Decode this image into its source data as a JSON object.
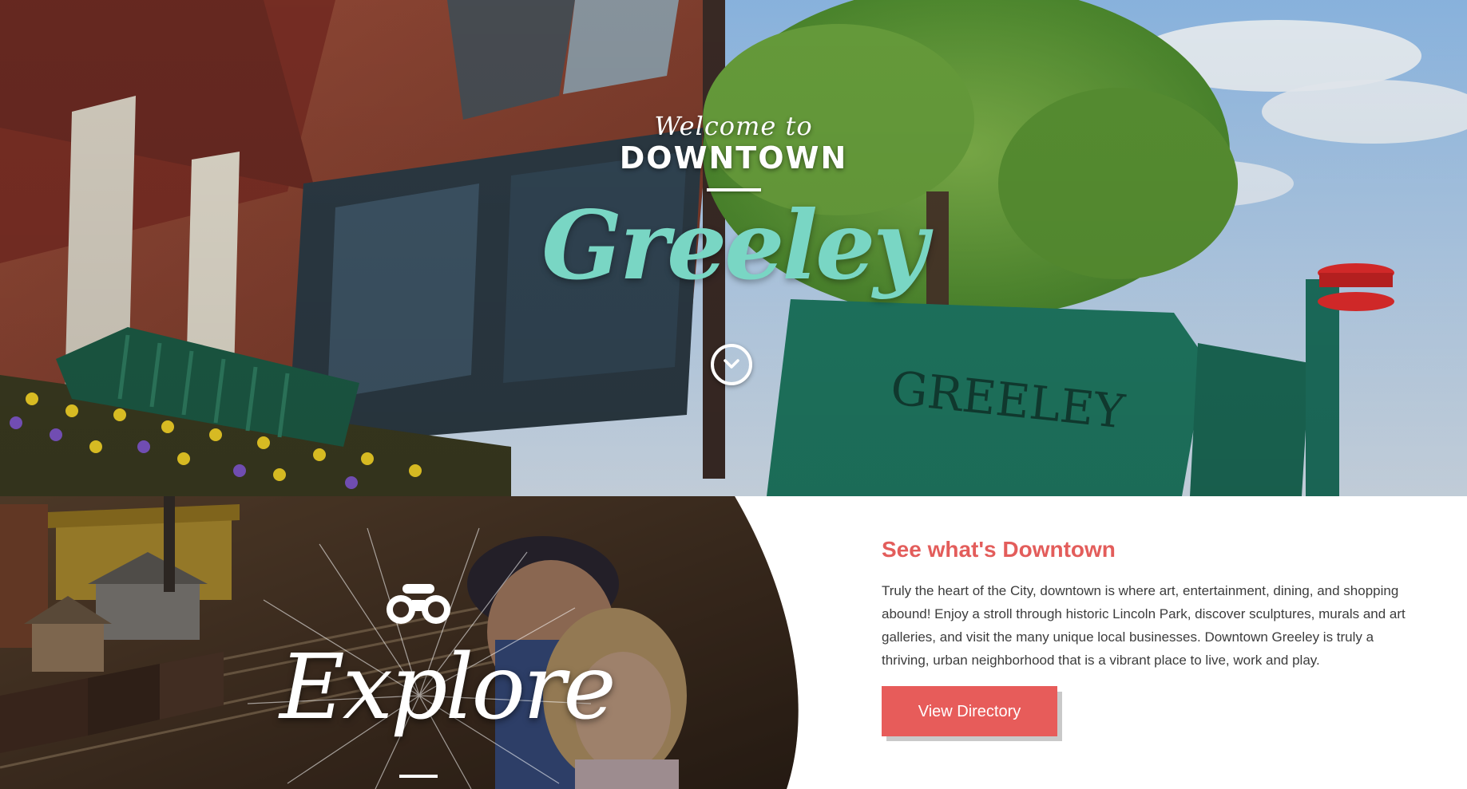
{
  "hero": {
    "welcome": "Welcome to",
    "downtown": "DOWNTOWN",
    "script_title": "Greeley",
    "sign_text": "GREELEY",
    "scroll_icon": "chevron-down-icon"
  },
  "explore": {
    "icon": "binoculars-icon",
    "label": "Explore"
  },
  "intro": {
    "heading": "See what's Downtown",
    "body": "Truly the heart of the City, downtown is where art, entertainment, dining, and shopping abound! Enjoy a stroll through historic Lincoln Park, discover sculptures, murals and art galleries, and visit the many unique local businesses. Downtown Greeley is truly a thriving, urban neighborhood that is a vibrant place to live, work and play.",
    "button_label": "View Directory"
  },
  "colors": {
    "accent": "#e35d5b",
    "script_teal": "#79d6c4",
    "sign_green": "#1f7a63"
  }
}
